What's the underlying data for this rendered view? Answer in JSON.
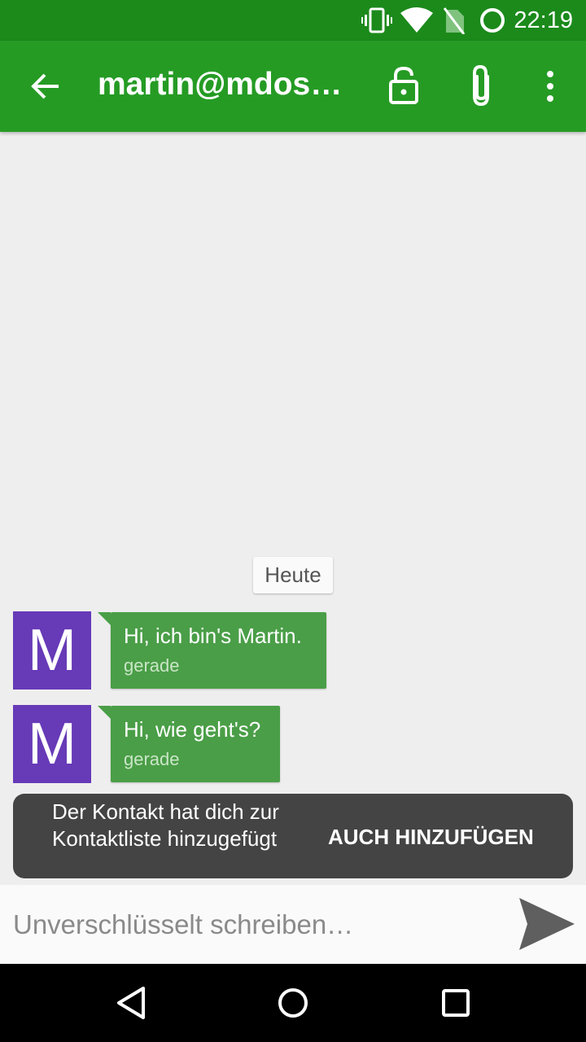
{
  "status_bar": {
    "time": "22:19",
    "icons": [
      "vibrate-icon",
      "wifi-icon",
      "no-sim-icon",
      "battery-charging-icon"
    ]
  },
  "app_bar": {
    "title": "martin@mdosc…",
    "icons": [
      "back-arrow-icon",
      "unlock-icon",
      "paperclip-icon",
      "overflow-menu-icon"
    ],
    "color": "#259b24"
  },
  "conversation": {
    "date_label": "Heute",
    "messages": [
      {
        "avatar_letter": "M",
        "text": "Hi, ich bin's Martin.",
        "time": "gerade"
      },
      {
        "avatar_letter": "M",
        "text": "Hi, wie geht's?",
        "time": "gerade"
      }
    ],
    "avatar_color": "#673ab7",
    "bubble_color": "#4a9e47"
  },
  "snackbar": {
    "message": "Der Kontakt hat dich zur Kontaktliste hinzugefügt",
    "action": "AUCH HINZUFÜGEN"
  },
  "composer": {
    "placeholder": "Unverschlüsselt schreiben…",
    "value": "",
    "send_icon": "send-icon"
  },
  "nav_bar": {
    "icons": [
      "nav-back-icon",
      "nav-home-icon",
      "nav-recents-icon"
    ]
  }
}
